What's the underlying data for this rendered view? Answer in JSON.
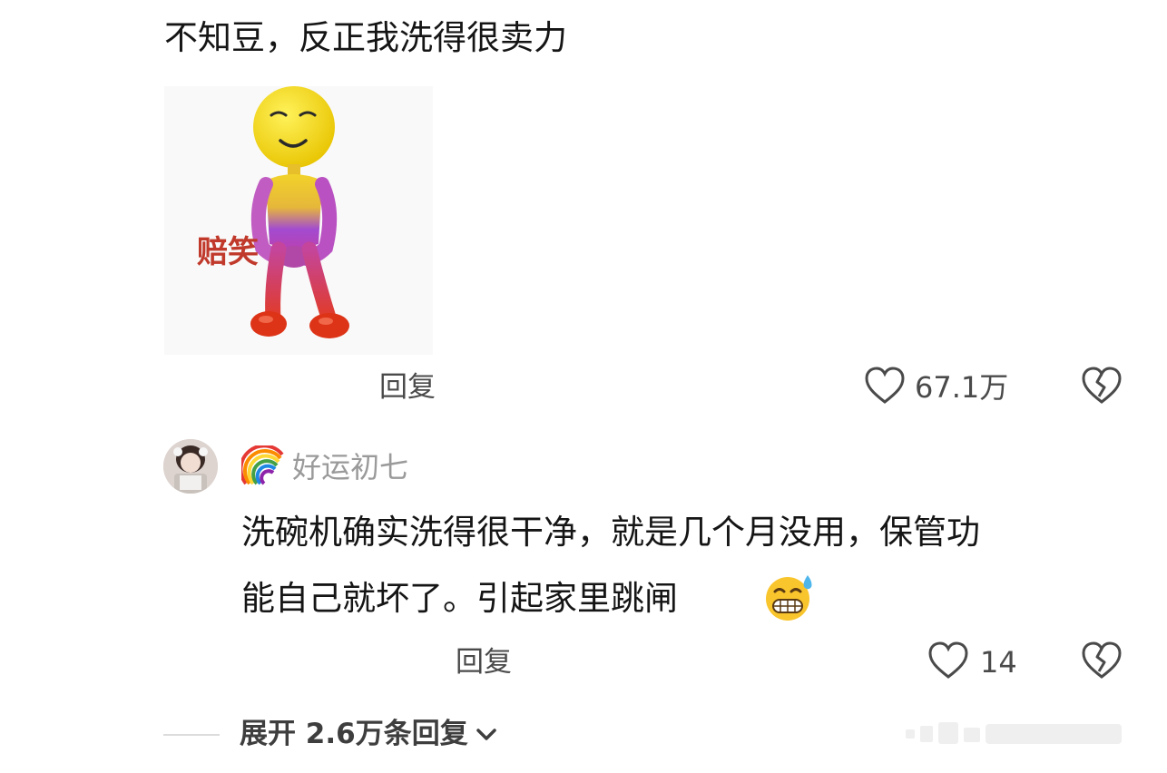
{
  "top_comment": {
    "text": "不知豆，反正我洗得很卖力",
    "sticker": {
      "caption": "赔笑"
    },
    "reply_label": "回复",
    "likes": "67.1万",
    "icons": {
      "like": "heart-outline-icon",
      "dislike": "broken-heart-icon"
    }
  },
  "reply_comment": {
    "username": "好运初七",
    "username_prefix_icon": "rainbow-icon",
    "text_line1": "洗碗机确实洗得很干净，就是几个月没用，保管功",
    "text_line2": "能自己就坏了。引起家里跳闸",
    "trailing_emoji": "grinning-sweat-emoji-icon",
    "reply_label": "回复",
    "likes": "14"
  },
  "expand_replies": {
    "label": "展开 2.6万条回复",
    "icon": "chevron-down-icon"
  },
  "colors": {
    "text": "#151515",
    "muted": "#4a4a4a",
    "username": "#9a9a9a",
    "sticker_caption": "#c0392b"
  }
}
